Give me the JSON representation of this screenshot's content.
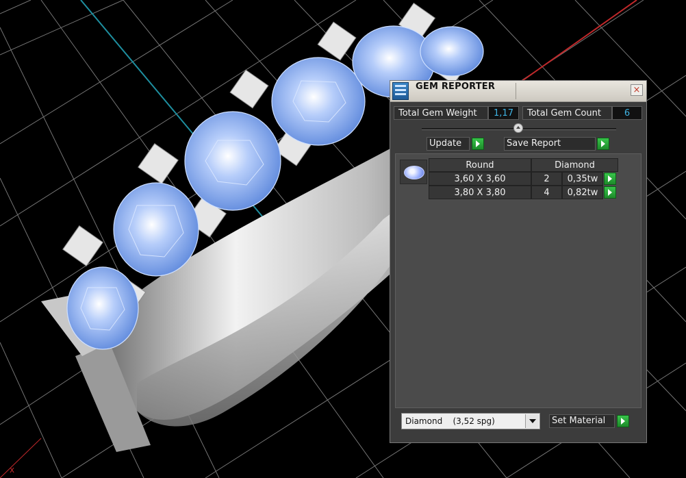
{
  "viewport": {
    "background": "#000000",
    "grid_color": "#8a8a8a",
    "axis_x_color": "#c0282a",
    "axis_y_color": "#1e8fa0",
    "gem_color": "#6e9be8",
    "metal_color": "#d8d8d8"
  },
  "panel": {
    "title": "GEM REPORTER",
    "icon": "gem-reporter-app-icon",
    "close_glyph": "×",
    "total_weight_label": "Total Gem Weight",
    "total_weight_value": "1,17",
    "total_count_label": "Total Gem Count",
    "total_count_value": "6",
    "update_label": "Update",
    "save_report_label": "Save Report",
    "table": {
      "headers": [
        "Round",
        "Diamond"
      ],
      "rows": [
        {
          "size": "3,60 X 3,60",
          "count": "2",
          "weight": "0,35tw"
        },
        {
          "size": "3,80 X 3,80",
          "count": "4",
          "weight": "0,82tw"
        }
      ]
    },
    "material": {
      "selected": "Diamond    (3,52 spg)",
      "set_label": "Set Material"
    },
    "accent_value_color": "#3fb4e4",
    "action_green": "#2aa83a"
  }
}
